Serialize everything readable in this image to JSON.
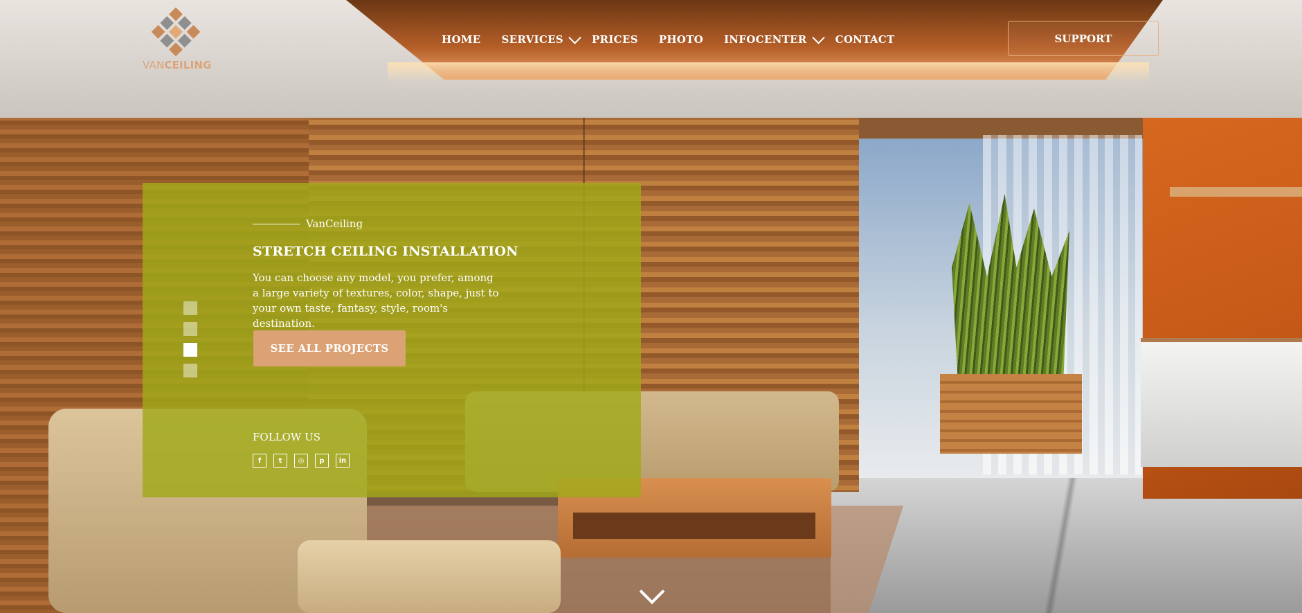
{
  "brand": {
    "name_part1": "VAN",
    "name_part2": "CEILING",
    "accent_color": "#dba275"
  },
  "nav": {
    "items": [
      {
        "label": "HOME",
        "has_dropdown": false,
        "icon": ""
      },
      {
        "label": "SERVICES",
        "has_dropdown": true,
        "icon": "chevron-down-icon"
      },
      {
        "label": "PRICES",
        "has_dropdown": false,
        "icon": ""
      },
      {
        "label": "PHOTO",
        "has_dropdown": false,
        "icon": ""
      },
      {
        "label": "INFOCENTER",
        "has_dropdown": true,
        "icon": "chevron-down-icon"
      },
      {
        "label": "CONTACT",
        "has_dropdown": false,
        "icon": ""
      }
    ]
  },
  "header": {
    "support_label": "SUPPORT"
  },
  "hero": {
    "eyebrow": "VanCeiling",
    "title": "STRETCH CEILING INSTALLATION",
    "description": "You can choose any model, you prefer, among a large variety of textures, color, shape, just to your own taste, fantasy, style, room's destination.",
    "cta_label": "SEE ALL PROJECTS",
    "follow_label": "FOLLOW US",
    "panel_color": "#a0aa19",
    "socials": [
      {
        "icon": "facebook-icon",
        "glyph": "f"
      },
      {
        "icon": "twitter-icon",
        "glyph": "t"
      },
      {
        "icon": "instagram-icon",
        "glyph": "◎"
      },
      {
        "icon": "pinterest-icon",
        "glyph": "p"
      },
      {
        "icon": "linkedin-icon",
        "glyph": "in"
      }
    ]
  },
  "slider": {
    "total": 4,
    "active_index": 2
  },
  "scroll": {
    "icon": "chevron-down-icon"
  }
}
